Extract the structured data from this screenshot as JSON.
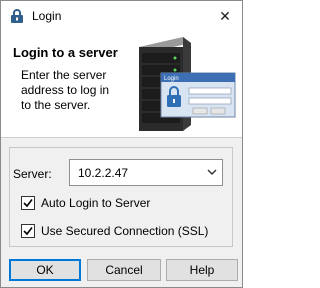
{
  "window": {
    "title": "Login",
    "close_glyph": "✕"
  },
  "header": {
    "title": "Login to a server",
    "description": "Enter the server address to log in to the server.",
    "illustration": {
      "dialog_title": "Login"
    }
  },
  "form": {
    "server_label": "Server:",
    "server_value": "10.2.2.47",
    "auto_login_label": "Auto Login to Server",
    "auto_login_checked": true,
    "ssl_label": "Use Secured Connection (SSL)",
    "ssl_checked": true
  },
  "buttons": {
    "ok": "OK",
    "cancel": "Cancel",
    "help": "Help"
  },
  "colors": {
    "accent": "#0078d7",
    "dialog_bg": "#f0f0f0",
    "header_bg": "#ffffff"
  }
}
